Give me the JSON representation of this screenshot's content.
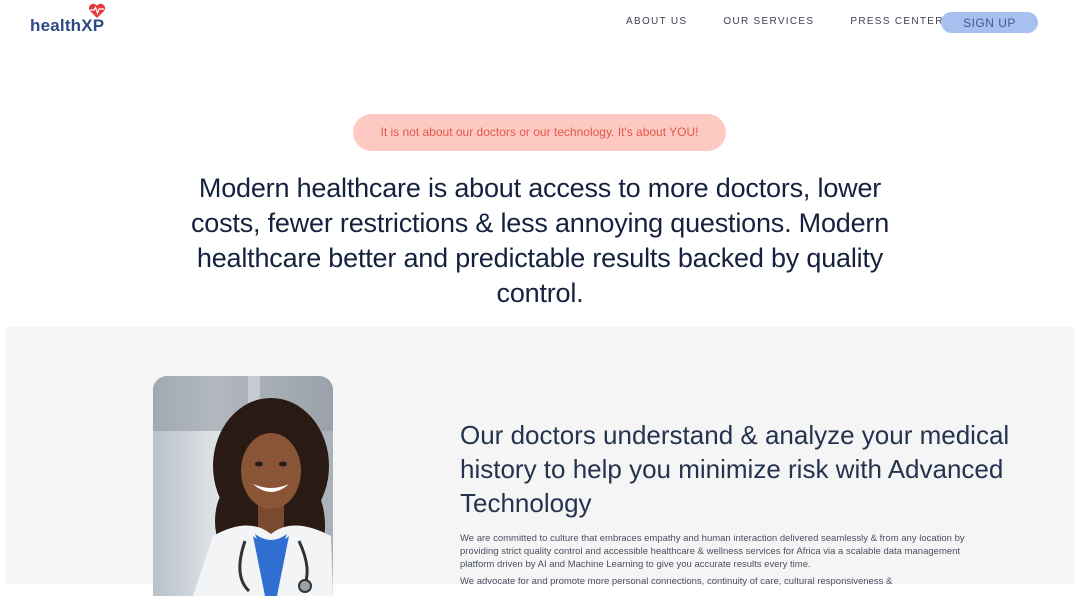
{
  "nav": {
    "logo_text": "healthXP",
    "links": [
      "ABOUT US",
      "OUR SERVICES",
      "PRESS CENTER"
    ],
    "signup_label": "SIGN UP"
  },
  "hero": {
    "tagline": "It is not about our doctors or our technology. It's about YOU!",
    "headline": "Modern healthcare is about access to more doctors, lower costs, fewer restrictions & less annoying questions. Modern healthcare better and predictable results backed by quality control."
  },
  "feature": {
    "title": "Our doctors understand & analyze your medical history to help you minimize risk with Advanced Technology",
    "body": "We are committed to culture that embraces empathy and human interaction delivered seamlessly & from any location by providing strict quality control and accessible healthcare & wellness services for Africa via a scalable data management platform driven by AI and Machine Learning to give you accurate results every time.",
    "body2": "We advocate for and promote more personal connections, continuity of care, cultural responsiveness &"
  },
  "colors": {
    "brand": "#2e4a86",
    "heart": "#e23b3b",
    "signup_bg": "#a7c0ef",
    "pill_bg": "#ffc9c3",
    "pill_text": "#e1584a",
    "section_bg": "#f5f5f6"
  },
  "icons": {
    "logo_mark": "heart-pulse-icon",
    "photo": "doctor-photo"
  }
}
